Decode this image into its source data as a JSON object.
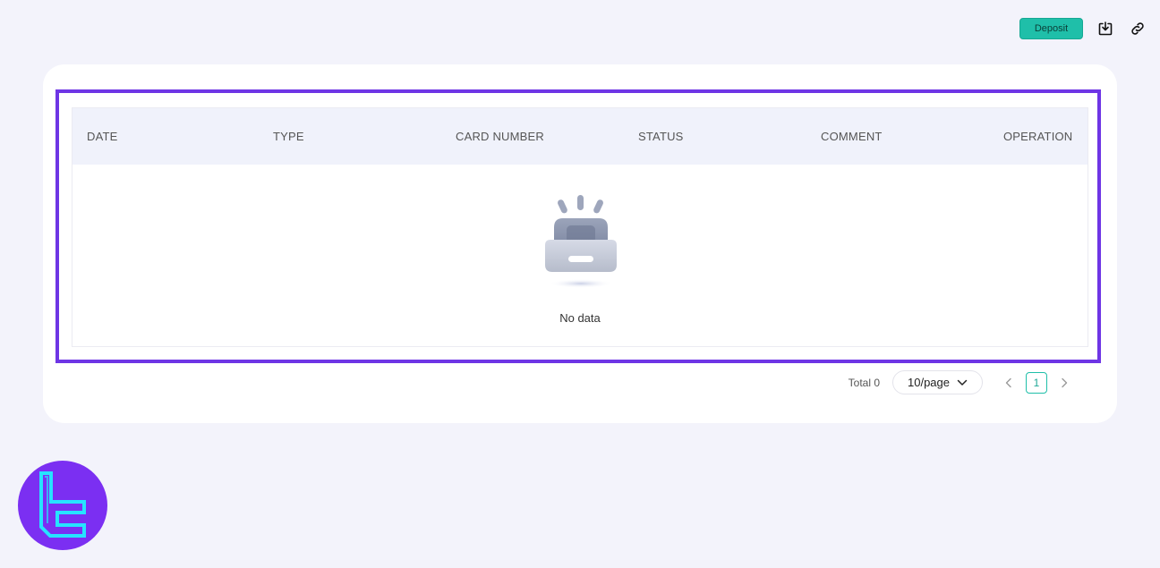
{
  "header": {
    "deposit_label": "Deposit",
    "icons": [
      "download-icon",
      "link-icon"
    ]
  },
  "table": {
    "columns": [
      "DATE",
      "TYPE",
      "CARD NUMBER",
      "STATUS",
      "COMMENT",
      "OPERATION"
    ],
    "rows": [],
    "empty_text": "No data"
  },
  "pagination": {
    "total_label": "Total 0",
    "page_size": "10/page",
    "current_page": "1"
  },
  "colors": {
    "accent": "#1fbfa9",
    "highlight": "#6e35e5",
    "background": "#f3f3fb",
    "logo": "#7b2ff2",
    "logo_mark": "#26e3ff"
  }
}
